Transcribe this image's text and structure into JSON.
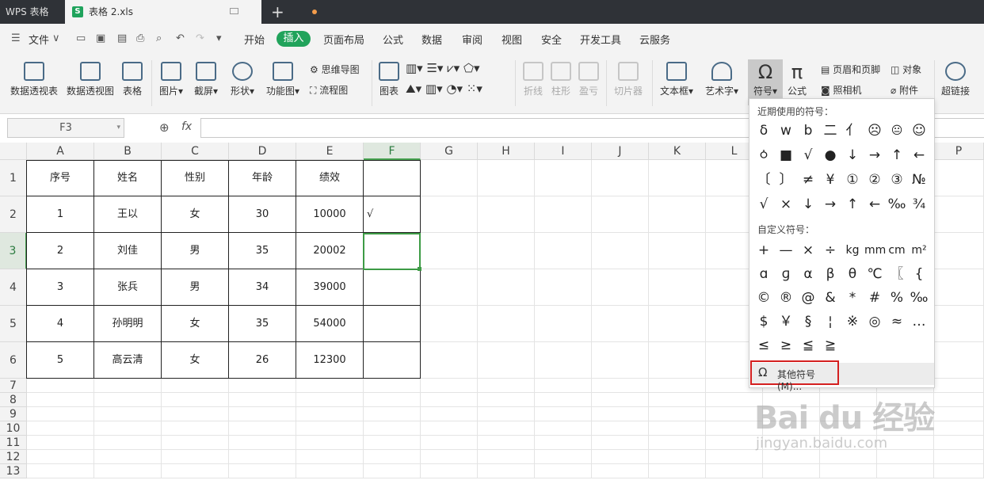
{
  "titlebar": {
    "app": "WPS 表格",
    "doc": "表格 2.xls",
    "new_tab": "+"
  },
  "menubar": {
    "file": "文件",
    "items": [
      "开始",
      "插入",
      "页面布局",
      "公式",
      "数据",
      "审阅",
      "视图",
      "安全",
      "开发工具",
      "云服务"
    ],
    "active": "插入"
  },
  "ribbon": {
    "pivot_table": "数据透视表",
    "pivot_chart": "数据透视图",
    "table": "表格",
    "picture": "图片",
    "screenshot": "截屏",
    "shapes": "形状",
    "function_chart": "功能图",
    "mindmap": "思维导图",
    "flowchart": "流程图",
    "chart": "图表",
    "line": "折线",
    "column": "柱形",
    "winloss": "盈亏",
    "slicer": "切片器",
    "textbox": "文本框",
    "wordart": "艺术字",
    "symbol": "符号",
    "formula": "公式",
    "header_footer": "页眉和页脚",
    "object": "对象",
    "camera": "照相机",
    "attachment": "附件",
    "hyperlink": "超链接"
  },
  "formula_bar": {
    "cell_ref": "F3",
    "fx": "fx",
    "value": ""
  },
  "columns": [
    "A",
    "B",
    "C",
    "D",
    "E",
    "F",
    "G",
    "H",
    "I",
    "J",
    "K",
    "L",
    "M",
    "N",
    "O",
    "P"
  ],
  "rows": [
    "1",
    "2",
    "3",
    "4",
    "5",
    "6",
    "7",
    "8",
    "9",
    "10",
    "11",
    "12",
    "13"
  ],
  "table": {
    "headers": [
      "序号",
      "姓名",
      "性别",
      "年龄",
      "绩效",
      ""
    ],
    "rows": [
      [
        "1",
        "王以",
        "女",
        "30",
        "10000",
        "√"
      ],
      [
        "2",
        "刘佳",
        "男",
        "35",
        "20002",
        ""
      ],
      [
        "3",
        "张兵",
        "男",
        "34",
        "39000",
        ""
      ],
      [
        "4",
        "孙明明",
        "女",
        "35",
        "54000",
        ""
      ],
      [
        "5",
        "高云清",
        "女",
        "26",
        "12300",
        ""
      ]
    ]
  },
  "symbol_popup": {
    "recent_title": "近期使用的符号：",
    "recent": [
      "δ",
      "w",
      "b",
      "二",
      "亻",
      "☹",
      "😐",
      "☺",
      "ㆁ",
      "■",
      "√",
      "●",
      "↓",
      "→",
      "↑",
      "←",
      "〔",
      "〕",
      "≠",
      "¥",
      "①",
      "②",
      "③",
      "№",
      "√",
      "×",
      "↓",
      "→",
      "↑",
      "←",
      "‰",
      "¾"
    ],
    "custom_title": "自定义符号：",
    "custom": [
      "+",
      "—",
      "×",
      "÷",
      "kg",
      "mm",
      "cm",
      "m²",
      "ɑ",
      "ɡ",
      "α",
      "β",
      "θ",
      "℃",
      "〖",
      "{",
      "©",
      "®",
      "@",
      "&",
      "*",
      "#",
      "%",
      "‰",
      "$",
      "￥",
      "§",
      "¦",
      "※",
      "◎",
      "≈",
      "…",
      "≤",
      "≥",
      "≦",
      "≧"
    ],
    "more": "其他符号(M)..."
  },
  "watermark": {
    "logo": "Bai du 经验",
    "url": "jingyan.baidu.com"
  }
}
